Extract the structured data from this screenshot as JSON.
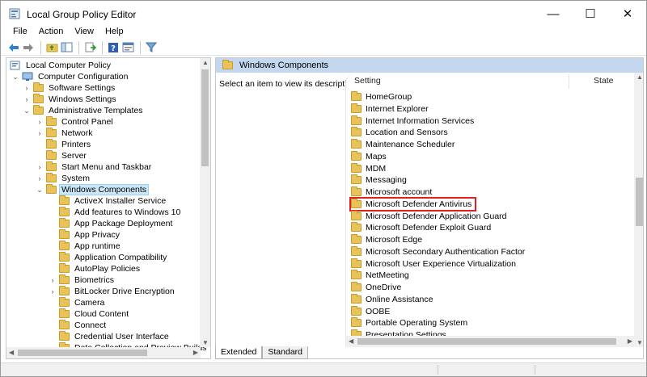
{
  "window": {
    "title": "Local Group Policy Editor",
    "controls": {
      "minimize": "—",
      "maximize": "☐",
      "close": "✕"
    }
  },
  "menu": [
    "File",
    "Action",
    "View",
    "Help"
  ],
  "toolbar": [
    "back-arrow-icon",
    "forward-arrow-icon",
    "up-folder-icon",
    "show-hide-tree-icon",
    "export-list-icon",
    "help-icon",
    "properties-icon",
    "filter-icon"
  ],
  "tree": [
    {
      "label": "Local Computer Policy",
      "level": 0,
      "chevron": "",
      "icon": "policy"
    },
    {
      "label": "Computer Configuration",
      "level": 1,
      "chevron": "down",
      "icon": "computer"
    },
    {
      "label": "Software Settings",
      "level": 2,
      "chevron": "right",
      "icon": "folder"
    },
    {
      "label": "Windows Settings",
      "level": 2,
      "chevron": "right",
      "icon": "folder"
    },
    {
      "label": "Administrative Templates",
      "level": 2,
      "chevron": "down",
      "icon": "folder"
    },
    {
      "label": "Control Panel",
      "level": 3,
      "chevron": "right",
      "icon": "folder"
    },
    {
      "label": "Network",
      "level": 3,
      "chevron": "right",
      "icon": "folder"
    },
    {
      "label": "Printers",
      "level": 3,
      "chevron": "",
      "icon": "folder"
    },
    {
      "label": "Server",
      "level": 3,
      "chevron": "",
      "icon": "folder"
    },
    {
      "label": "Start Menu and Taskbar",
      "level": 3,
      "chevron": "right",
      "icon": "folder"
    },
    {
      "label": "System",
      "level": 3,
      "chevron": "right",
      "icon": "folder"
    },
    {
      "label": "Windows Components",
      "level": 3,
      "chevron": "down",
      "icon": "folder",
      "selected": true
    },
    {
      "label": "ActiveX Installer Service",
      "level": 4,
      "chevron": "",
      "icon": "folder"
    },
    {
      "label": "Add features to Windows 10",
      "level": 4,
      "chevron": "",
      "icon": "folder"
    },
    {
      "label": "App Package Deployment",
      "level": 4,
      "chevron": "",
      "icon": "folder"
    },
    {
      "label": "App Privacy",
      "level": 4,
      "chevron": "",
      "icon": "folder"
    },
    {
      "label": "App runtime",
      "level": 4,
      "chevron": "",
      "icon": "folder"
    },
    {
      "label": "Application Compatibility",
      "level": 4,
      "chevron": "",
      "icon": "folder"
    },
    {
      "label": "AutoPlay Policies",
      "level": 4,
      "chevron": "",
      "icon": "folder"
    },
    {
      "label": "Biometrics",
      "level": 4,
      "chevron": "right",
      "icon": "folder"
    },
    {
      "label": "BitLocker Drive Encryption",
      "level": 4,
      "chevron": "right",
      "icon": "folder"
    },
    {
      "label": "Camera",
      "level": 4,
      "chevron": "",
      "icon": "folder"
    },
    {
      "label": "Cloud Content",
      "level": 4,
      "chevron": "",
      "icon": "folder"
    },
    {
      "label": "Connect",
      "level": 4,
      "chevron": "",
      "icon": "folder"
    },
    {
      "label": "Credential User Interface",
      "level": 4,
      "chevron": "",
      "icon": "folder"
    },
    {
      "label": "Data Collection and Preview Builds",
      "level": 4,
      "chevron": "",
      "icon": "folder"
    }
  ],
  "right_pane": {
    "header": "Windows Components",
    "description": "Select an item to view its description.",
    "columns": {
      "setting": "Setting",
      "state": "State"
    },
    "items": [
      {
        "label": "HomeGroup"
      },
      {
        "label": "Internet Explorer"
      },
      {
        "label": "Internet Information Services"
      },
      {
        "label": "Location and Sensors"
      },
      {
        "label": "Maintenance Scheduler"
      },
      {
        "label": "Maps"
      },
      {
        "label": "MDM"
      },
      {
        "label": "Messaging"
      },
      {
        "label": "Microsoft account"
      },
      {
        "label": "Microsoft Defender Antivirus",
        "highlighted": true
      },
      {
        "label": "Microsoft Defender Application Guard"
      },
      {
        "label": "Microsoft Defender Exploit Guard"
      },
      {
        "label": "Microsoft Edge"
      },
      {
        "label": "Microsoft Secondary Authentication Factor"
      },
      {
        "label": "Microsoft User Experience Virtualization"
      },
      {
        "label": "NetMeeting"
      },
      {
        "label": "OneDrive"
      },
      {
        "label": "Online Assistance"
      },
      {
        "label": "OOBE"
      },
      {
        "label": "Portable Operating System"
      },
      {
        "label": "Presentation Settings"
      }
    ]
  },
  "tabs": [
    "Extended",
    "Standard"
  ],
  "colors": {
    "highlight_box": "#e02020",
    "selection": "#cde6f7",
    "header_bar": "#c3d8ee",
    "folder": "#e8c35a"
  }
}
